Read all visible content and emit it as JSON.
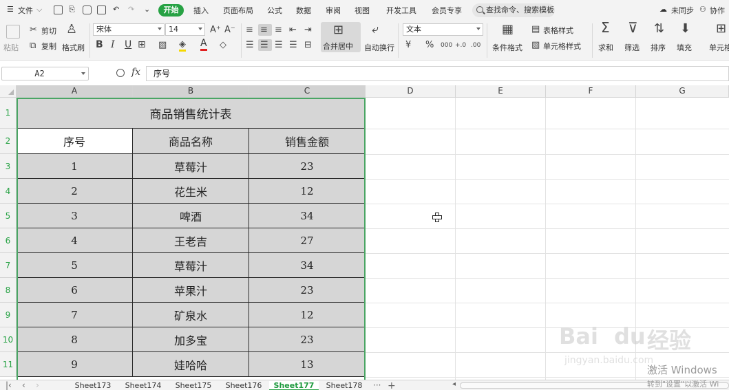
{
  "menubar": {
    "file": "文件",
    "tabs": [
      "开始",
      "插入",
      "页面布局",
      "公式",
      "数据",
      "审阅",
      "视图",
      "开发工具",
      "会员专享"
    ],
    "search": "查找命令、搜索模板",
    "sync": "未同步",
    "collab": "协作"
  },
  "ribbon": {
    "paste": "粘贴",
    "cut": "剪切",
    "copy": "复制",
    "format_painter": "格式刷",
    "font_name": "宋体",
    "font_size": "14",
    "merge_center": "合并居中",
    "wrap_text": "自动换行",
    "number_format": "文本",
    "currency": "¥",
    "percent": "%",
    "thousands": "000",
    "inc_dec": "+.0",
    "dec_dec": ".00",
    "cond_format": "条件格式",
    "table_style": "表格样式",
    "cell_style": "单元格样式",
    "sum": "求和",
    "filter": "筛选",
    "sort": "排序",
    "fill": "填充",
    "cell": "单元格"
  },
  "formula_bar": {
    "cell_ref": "A2",
    "fx": "fx",
    "content": "序号"
  },
  "grid": {
    "columns": [
      "A",
      "B",
      "C",
      "D",
      "E",
      "F",
      "G"
    ],
    "rows": [
      "1",
      "2",
      "3",
      "4",
      "5",
      "6",
      "7",
      "8",
      "9",
      "10",
      "11"
    ],
    "title": "商品销售统计表",
    "headers": [
      "序号",
      "商品名称",
      "销售金额"
    ],
    "data": [
      [
        "1",
        "草莓汁",
        "23"
      ],
      [
        "2",
        "花生米",
        "12"
      ],
      [
        "3",
        "啤酒",
        "34"
      ],
      [
        "4",
        "王老吉",
        "27"
      ],
      [
        "5",
        "草莓汁",
        "34"
      ],
      [
        "6",
        "苹果汁",
        "23"
      ],
      [
        "7",
        "矿泉水",
        "12"
      ],
      [
        "8",
        "加多宝",
        "23"
      ],
      [
        "9",
        "娃哈哈",
        "13"
      ]
    ]
  },
  "sheets": {
    "tabs": [
      "Sheet173",
      "Sheet174",
      "Sheet175",
      "Sheet176",
      "Sheet177",
      "Sheet178"
    ],
    "active": "Sheet177",
    "more": "···",
    "add": "+"
  },
  "watermark": {
    "brand": "Bai",
    "brand2": "du",
    "brand3": "经验",
    "sub": "jingyan.baidu.com",
    "activate_line1": "激活 Windows",
    "activate_line2": "转到\"设置\"以激活 Wi"
  },
  "colors": {
    "accent_green": "#27a244",
    "selection_fill": "#d6d6d6"
  }
}
